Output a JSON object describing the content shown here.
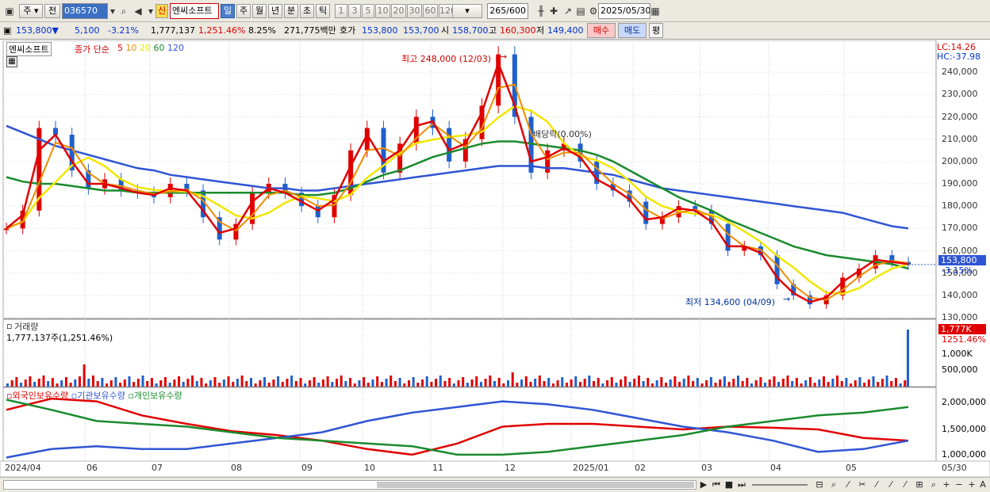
{
  "toolbar": {
    "period": "주",
    "prev": "전",
    "code": "036570",
    "badge": "신",
    "name": "엔씨소프트",
    "timeframes": [
      "일",
      "주",
      "월",
      "년",
      "분",
      "초",
      "틱"
    ],
    "active_timeframe": "일",
    "minutes": [
      "1",
      "3",
      "5",
      "10",
      "20",
      "30",
      "60",
      "120"
    ],
    "count": "265",
    "count_total": "/600",
    "date": "2025/05/30"
  },
  "quote": {
    "price": "153,800",
    "arrow": "▼",
    "change": "5,100",
    "change_pct": "-3.21%",
    "volume": "1,777,137",
    "volume_pct": "1,251.46%",
    "turnover": "8.25%",
    "amount": "271,775백만",
    "ask_label": "호가",
    "ask": "153,800",
    "bid": "153,700",
    "open_label": "시",
    "open": "158,700",
    "high_label": "고",
    "high": "160,300",
    "low_label": "저",
    "low": "149,400",
    "buy": "매수",
    "sell": "매도",
    "eval": "평"
  },
  "price_panel": {
    "stock_label": "엔씨소프트",
    "ma_title": "종가 단순",
    "ma_periods": [
      "5",
      "10",
      "20",
      "60",
      "120"
    ],
    "ma_colors": [
      "#e00000",
      "#f08c00",
      "#f2e600",
      "#1a8a2e",
      "#2f55d4"
    ],
    "lc": "LC:14.26",
    "hc": "HC:-37.98",
    "high_note": "최고 248,000 (12/03)",
    "low_note": "최저 134,600 (04/09)",
    "dividend_note": "배당락(0.00%)",
    "current_price_tag": "153,800",
    "current_pct_tag": "-3.15%",
    "y_ticks": [
      "240,000",
      "230,000",
      "220,000",
      "210,000",
      "200,000",
      "190,000",
      "180,000",
      "170,000",
      "160,000",
      "150,000",
      "140,000",
      "130,000"
    ]
  },
  "volume_panel": {
    "title": "거래량",
    "value": "1,777,137주(1,251.46%)",
    "tag_value": "1,777K",
    "tag_pct": "1251.46%",
    "y_ticks": [
      "1,000K",
      "500,000"
    ]
  },
  "holding_panel": {
    "series": [
      "외국인보유수량",
      "기관보유수량",
      "개인보유수량"
    ],
    "colors": [
      "#e00000",
      "#2f55d4",
      "#1a8a2e"
    ],
    "y_ticks": [
      "2,000,000",
      "1,500,000",
      "1,000,000"
    ]
  },
  "x_axis": [
    "2024/04",
    "06",
    "07",
    "08",
    "09",
    "10",
    "11",
    "12",
    "2025/01",
    "02",
    "03",
    "04",
    "05",
    "05/30"
  ],
  "chart_data": {
    "type": "line",
    "title": "",
    "y_range_price": [
      130000,
      250000
    ],
    "candles_close_approx": [
      170000,
      178000,
      215000,
      212000,
      196000,
      188000,
      192000,
      187000,
      186000,
      184000,
      190000,
      187000,
      175000,
      165000,
      172000,
      186000,
      190000,
      186000,
      180000,
      175000,
      185000,
      205000,
      215000,
      195000,
      208000,
      220000,
      215000,
      200000,
      210000,
      225000,
      248000,
      220000,
      195000,
      205000,
      208000,
      200000,
      190000,
      187000,
      182000,
      172000,
      175000,
      180000,
      178000,
      172000,
      160000,
      162000,
      158000,
      145000,
      140000,
      136000,
      140000,
      148000,
      152000,
      158000,
      155000,
      153800
    ],
    "ma5": [
      170000,
      176000,
      205000,
      212000,
      200000,
      190000,
      190000,
      188000,
      186000,
      185000,
      188000,
      187000,
      178000,
      168000,
      170000,
      182000,
      188000,
      186000,
      182000,
      178000,
      183000,
      198000,
      212000,
      200000,
      205000,
      216000,
      218000,
      205000,
      208000,
      222000,
      244000,
      225000,
      200000,
      202000,
      206000,
      202000,
      192000,
      188000,
      183000,
      174000,
      175000,
      179000,
      178000,
      173000,
      162000,
      162000,
      159000,
      148000,
      141000,
      137000,
      139000,
      146000,
      151000,
      156000,
      155000,
      154000
    ],
    "ma60": [
      193000,
      191000,
      190000,
      190000,
      189000,
      188000,
      187000,
      187000,
      186000,
      186000,
      186000,
      186000,
      186000,
      186000,
      186000,
      186000,
      186000,
      186000,
      185000,
      185000,
      186000,
      188000,
      191000,
      194000,
      196000,
      199000,
      202000,
      204000,
      206000,
      208000,
      209000,
      209000,
      208000,
      207000,
      206000,
      205000,
      203000,
      200000,
      196000,
      192000,
      188000,
      184000,
      181000,
      178000,
      174000,
      171000,
      168000,
      165000,
      162000,
      160000,
      158000,
      157000,
      156000,
      155000,
      154000,
      152000
    ],
    "ma120": [
      216000,
      213000,
      210000,
      207000,
      205000,
      203000,
      201000,
      199000,
      197000,
      196000,
      194000,
      193000,
      192000,
      191000,
      190000,
      189000,
      188000,
      188000,
      187000,
      187000,
      188000,
      189000,
      190000,
      191000,
      192000,
      193000,
      194000,
      195000,
      196000,
      197000,
      198000,
      198000,
      198000,
      197000,
      197000,
      196000,
      195000,
      194000,
      192000,
      190000,
      188000,
      187000,
      186000,
      185000,
      184000,
      183000,
      182000,
      181000,
      180000,
      179000,
      178000,
      177000,
      175000,
      173000,
      171000,
      170000
    ],
    "volume_last": 1777137
  }
}
